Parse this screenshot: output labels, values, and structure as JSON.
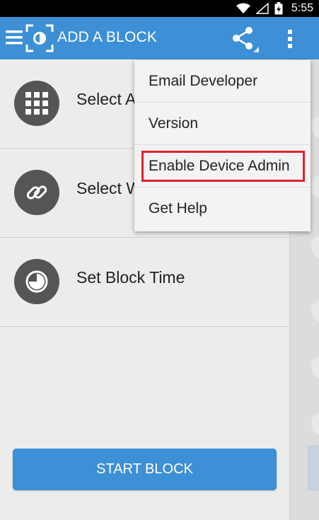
{
  "status_bar": {
    "time": "5:55",
    "icons": [
      "wifi-icon",
      "signal-icon",
      "battery-charging-icon"
    ]
  },
  "app_bar": {
    "title": "ADD A BLOCK",
    "icons": [
      "menu-icon",
      "app-logo-icon",
      "share-icon",
      "overflow-menu-icon"
    ],
    "color": "#3d8fd6"
  },
  "list": {
    "items": [
      {
        "label": "Select A",
        "icon": "apps-grid-icon"
      },
      {
        "label": "Select W",
        "icon": "link-icon"
      },
      {
        "label": "Set Block Time",
        "icon": "clock-pie-icon"
      }
    ]
  },
  "start_button": {
    "label": "START BLOCK"
  },
  "overflow_menu": {
    "items": [
      {
        "label": "Email Developer"
      },
      {
        "label": "Version"
      },
      {
        "label": "Enable Device Admin",
        "highlighted": true
      },
      {
        "label": "Get Help"
      }
    ],
    "highlight_color": "#e0212d"
  }
}
